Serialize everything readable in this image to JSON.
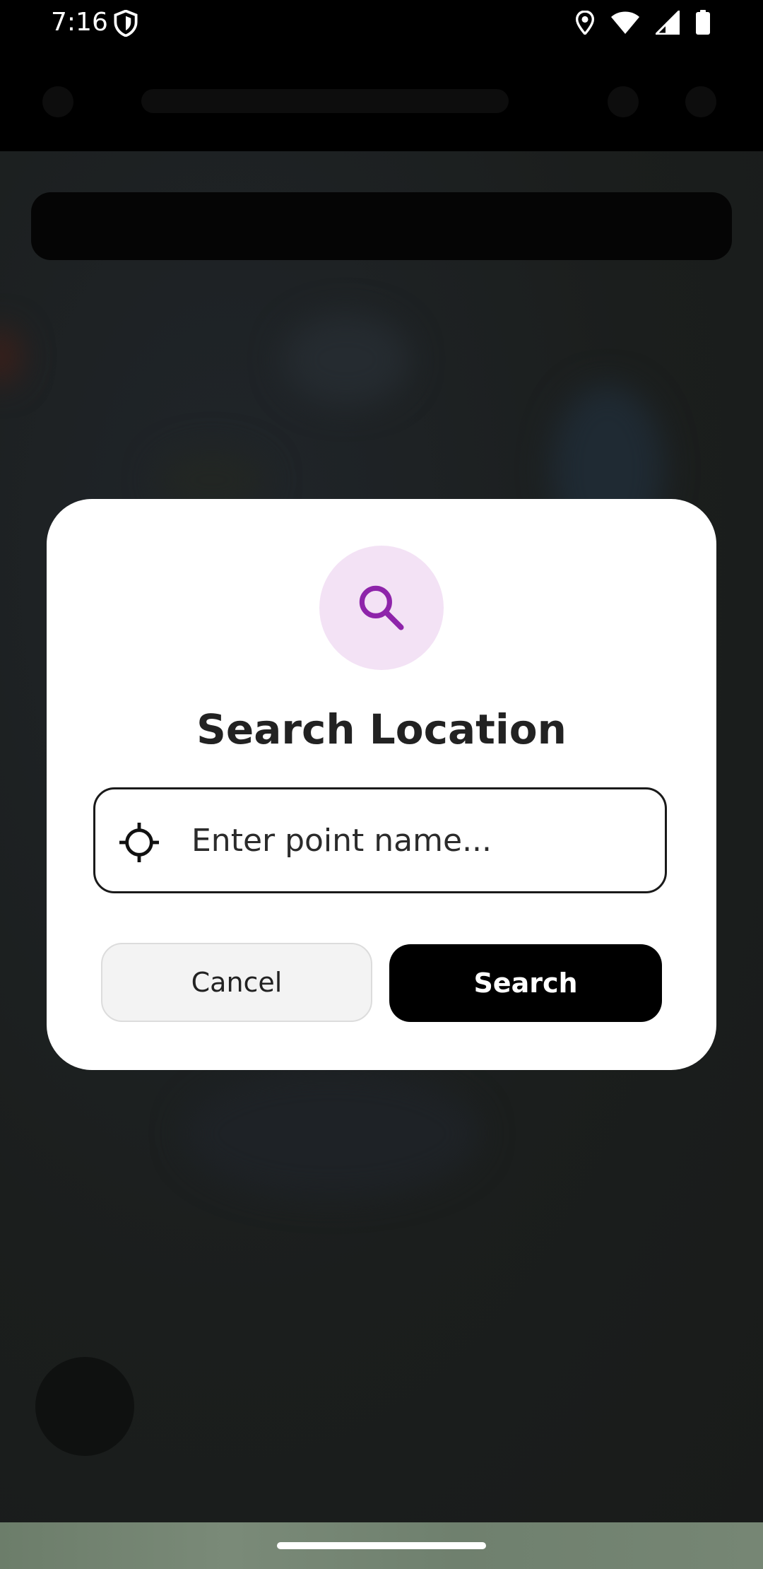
{
  "status_bar": {
    "time": "7:16",
    "icons": [
      "shield-icon",
      "location-icon",
      "wifi-icon",
      "signal-icon",
      "battery-icon"
    ]
  },
  "dialog": {
    "icon": "search-icon",
    "title": "Search Location",
    "field": {
      "icon": "crosshair-icon",
      "value": "",
      "placeholder": "Enter point name..."
    },
    "cancel_label": "Cancel",
    "search_label": "Search"
  },
  "colors": {
    "accent": "#8e24aa",
    "icon_circle": "#f3e2f5",
    "primary_button": "#000000",
    "secondary_button": "#f3f3f3",
    "scrim": "#1c1f1e"
  }
}
